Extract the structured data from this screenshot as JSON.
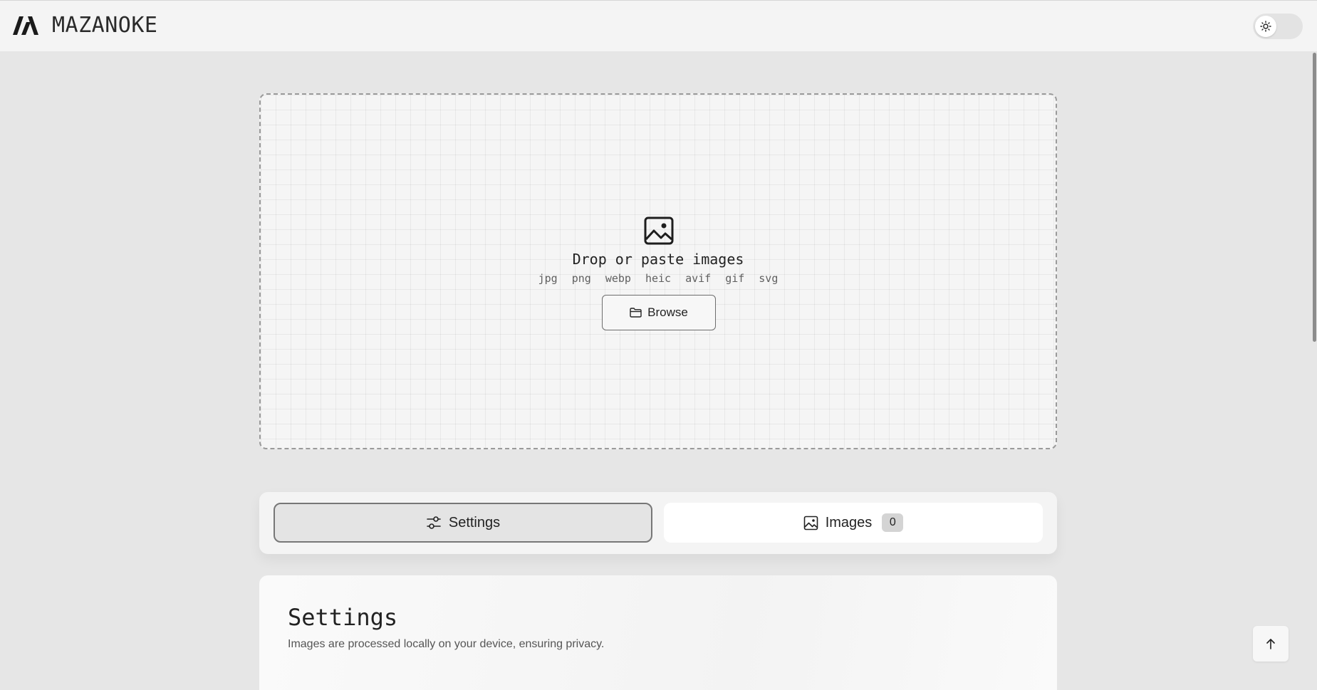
{
  "header": {
    "brand": "MAZANOKE",
    "logo_icon": "mazanoke-logo",
    "theme_toggle_icon": "sun-icon"
  },
  "dropzone": {
    "icon": "image-icon",
    "title": "Drop or paste images",
    "formats": [
      "jpg",
      "png",
      "webp",
      "heic",
      "avif",
      "gif",
      "svg"
    ],
    "browse_label": "Browse",
    "browse_icon": "folder-icon"
  },
  "tabs": {
    "settings": {
      "label": "Settings",
      "icon": "sliders-icon",
      "active": true
    },
    "images": {
      "label": "Images",
      "icon": "image-icon",
      "count": "0"
    }
  },
  "settings": {
    "title": "Settings",
    "description": "Images are processed locally on your device, ensuring privacy."
  },
  "scroll_top": {
    "icon": "arrow-up-icon"
  },
  "colors": {
    "background": "#e6e6e6",
    "header": "#f4f4f4",
    "accent_border": "#777777"
  }
}
